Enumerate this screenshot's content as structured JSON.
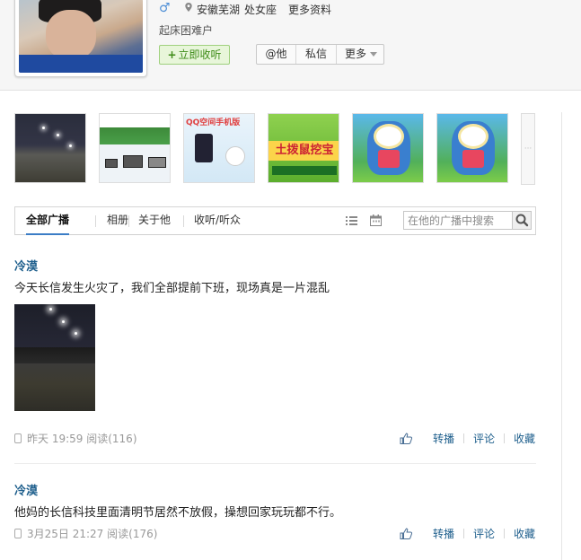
{
  "profile": {
    "gender_icon": "male-icon",
    "location": "安徽芜湖",
    "zodiac": "处女座",
    "more_info": "更多资料",
    "bio": "起床困难户"
  },
  "actions": {
    "follow": "立即收听",
    "at": "@他",
    "message": "私信",
    "more": "更多"
  },
  "tabs": [
    {
      "label": "全部广播"
    },
    {
      "label": "相册"
    },
    {
      "label": "关于他"
    },
    {
      "label": "收听/听众"
    }
  ],
  "search": {
    "placeholder": "在他的广播中搜索"
  },
  "thumbnails": {
    "t4_text": "土拨鼠挖宝",
    "t3_text": "QQ空间手机版"
  },
  "posts": [
    {
      "author": "冷漠",
      "text": "今天长信发生火灾了，我们全部提前下班，现场真是一片混乱",
      "time": "昨天 19:59",
      "reads": "阅读(116)",
      "repost": "转播",
      "comment": "评论",
      "favorite": "收藏"
    },
    {
      "author": "冷漠",
      "text": "他妈的长信科技里面清明节居然不放假，操想回家玩玩都不行。",
      "time": "3月25日 21:27",
      "reads": "阅读(176)",
      "repost": "转播",
      "comment": "评论",
      "favorite": "收藏"
    }
  ],
  "colors": {
    "accent_blue": "#1d5e8c",
    "tab_underline": "#3b7dc6",
    "follow_green": "#3d8b17"
  }
}
